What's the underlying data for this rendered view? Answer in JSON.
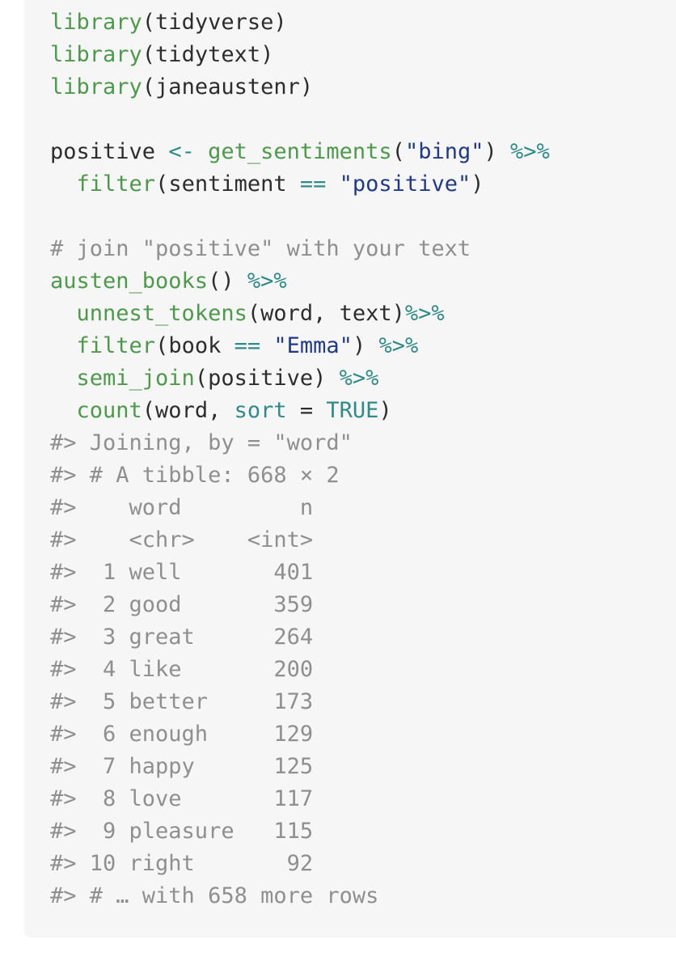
{
  "code": {
    "lib1_fn": "library",
    "lib1_rest": "(tidyverse)",
    "lib2_fn": "library",
    "lib2_rest": "(tidytext)",
    "lib3_fn": "library",
    "lib3_rest": "(janeaustenr)",
    "pos_var": "positive ",
    "pos_assign": "<-",
    "pos_fn": "get_sentiments",
    "pos_open": "(",
    "pos_str": "\"bing\"",
    "pos_close": ") ",
    "pos_pipe": "%>%",
    "filt_indent": "  ",
    "filt_fn": "filter",
    "filt_arg": "(sentiment ",
    "filt_eq": "==",
    "filt_str": "\"positive\"",
    "filt_close": ")",
    "comment": "# join \"positive\" with your text",
    "ab_fn": "austen_books",
    "ab_rest": "() ",
    "ab_pipe": "%>%",
    "ut_fn": "unnest_tokens",
    "ut_rest": "(word, text)",
    "ut_pipe": "%>%",
    "fb_fn": "filter",
    "fb_arg": "(book ",
    "fb_eq": "==",
    "fb_str": "\"Emma\"",
    "fb_close": ") ",
    "fb_pipe": "%>%",
    "sj_fn": "semi_join",
    "sj_rest": "(positive) ",
    "sj_pipe": "%>%",
    "ct_fn": "count",
    "ct_arg": "(word, ",
    "ct_sort": "sort",
    "ct_eq": " = ",
    "ct_true": "TRUE",
    "ct_close": ")"
  },
  "output": [
    "#> Joining, by = \"word\"",
    "#> # A tibble: 668 × 2",
    "#>    word         n",
    "#>    <chr>    <int>",
    "#>  1 well       401",
    "#>  2 good       359",
    "#>  3 great      264",
    "#>  4 like       200",
    "#>  5 better     173",
    "#>  6 enough     129",
    "#>  7 happy      125",
    "#>  8 love       117",
    "#>  9 pleasure   115",
    "#> 10 right       92",
    "#> # … with 658 more rows"
  ]
}
